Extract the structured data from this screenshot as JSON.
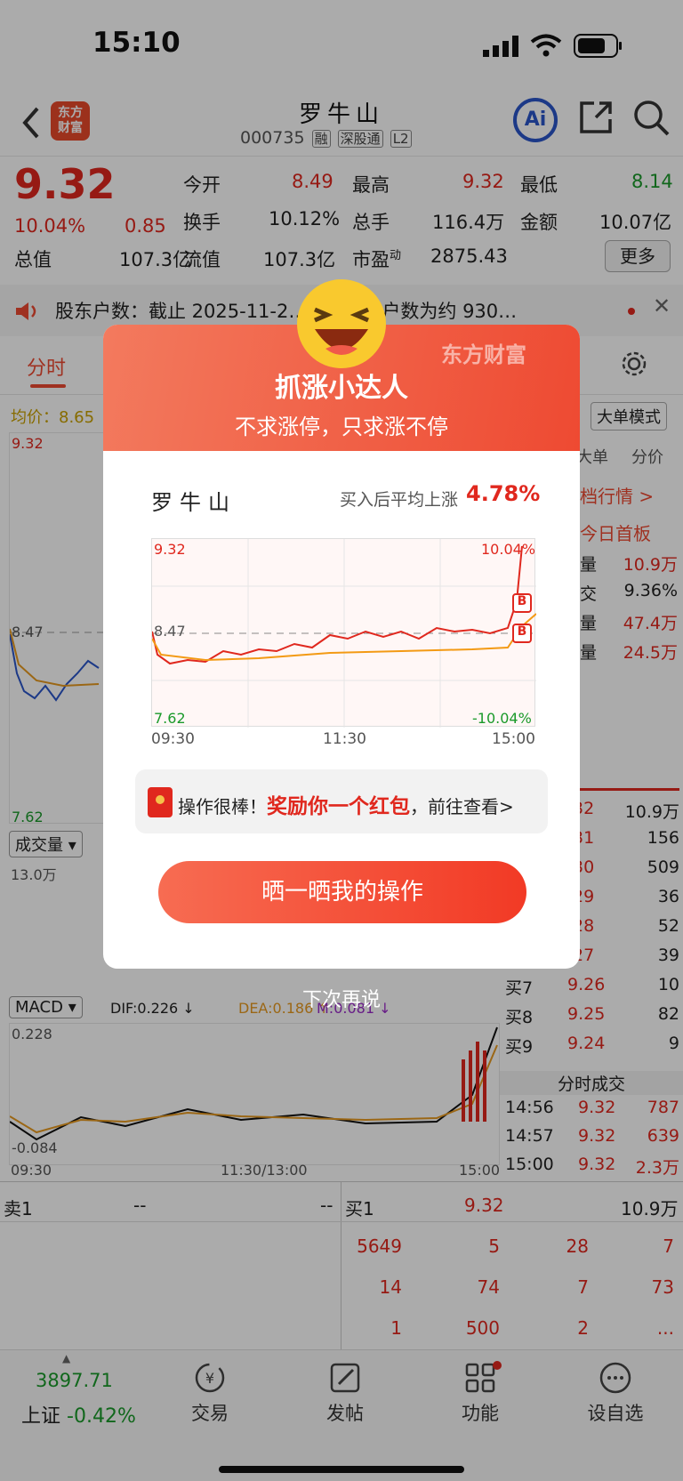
{
  "status_bar": {
    "time": "15:10"
  },
  "header": {
    "logo_text": "东方\n财富",
    "stock_name": "罗牛山",
    "code": "000735",
    "tags": [
      "融",
      "深股通",
      "L2"
    ],
    "ai_label": "Ai"
  },
  "quote": {
    "price": "9.32",
    "pct": "10.04%",
    "change": "0.85",
    "rows": [
      [
        {
          "label": "今开",
          "value": "8.49",
          "cls": "red"
        },
        {
          "label": "最高",
          "value": "9.32",
          "cls": "red"
        },
        {
          "label": "最低",
          "value": "8.14",
          "cls": "green"
        }
      ],
      [
        {
          "label": "换手",
          "value": "10.12%",
          "cls": ""
        },
        {
          "label": "总手",
          "value": "116.4万",
          "cls": ""
        },
        {
          "label": "金额",
          "value": "10.07亿",
          "cls": ""
        }
      ]
    ],
    "zongzhi_label": "总值",
    "zongzhi": "107.3亿",
    "liuzhi_label": "流值",
    "liuzhi": "107.3亿",
    "shiying_label": "市盈",
    "shiying_sup": "动",
    "shiying": "2875.43",
    "more_button": "更多"
  },
  "notice": {
    "text": "股东户数：截止 2025-11-2… A股股东户数为约 930…"
  },
  "tabs": {
    "active": "分时",
    "junjia_label": "均价：",
    "junjia": "8.65",
    "dadan_mode": "大单模式"
  },
  "right_panel": {
    "headers": [
      "大单",
      "分价"
    ],
    "link": "档行情 >",
    "first_board": "今日首板",
    "stats": [
      {
        "label": "量",
        "value": "10.9万"
      },
      {
        "label": "交",
        "value": "9.36%"
      },
      {
        "label": "量",
        "value": "47.4万"
      },
      {
        "label": "量",
        "value": "24.5万"
      }
    ],
    "book": [
      {
        "label": "",
        "price": ".32",
        "vol": "10.9万"
      },
      {
        "label": "",
        "price": ".31",
        "vol": "156"
      },
      {
        "label": "",
        "price": ".30",
        "vol": "509"
      },
      {
        "label": "",
        "price": ".29",
        "vol": "36"
      },
      {
        "label": "",
        "price": ".28",
        "vol": "52"
      },
      {
        "label": "",
        "price": ".27",
        "vol": "39"
      },
      {
        "label": "买7",
        "price": "9.26",
        "vol": "10"
      },
      {
        "label": "买8",
        "price": "9.25",
        "vol": "82"
      },
      {
        "label": "买9",
        "price": "9.24",
        "vol": "9"
      }
    ],
    "trades_title": "分时成交",
    "trades": [
      {
        "time": "14:56",
        "price": "9.32",
        "vol": "787"
      },
      {
        "time": "14:57",
        "price": "9.32",
        "vol": "639"
      },
      {
        "time": "15:00",
        "price": "9.32",
        "vol": "2.3万"
      }
    ]
  },
  "main_chart": {
    "top": "9.32",
    "ref": "8.47",
    "low": "7.62",
    "vol_label": "成交量",
    "vol_max": "13.0万",
    "macd_label": "MACD",
    "dif": "DIF:0.226 ↓",
    "dea": "DEA:0.186 ↑",
    "m": "M:0.081 ↓",
    "macd_top": "0.228",
    "macd_bottom": "-0.084",
    "x_labels": [
      "09:30",
      "11:30/13:00",
      "15:00"
    ]
  },
  "order_book_bottom": {
    "sell_label": "卖1",
    "sell_price": "--",
    "sell_vol": "--",
    "buy_label": "买1",
    "buy_price": "9.32",
    "buy_vol": "10.9万",
    "rows": [
      [
        "5649",
        "5",
        "28",
        "7"
      ],
      [
        "14",
        "74",
        "7",
        "73"
      ],
      [
        "1",
        "500",
        "2",
        "..."
      ]
    ]
  },
  "modal": {
    "title": "抓涨小达人",
    "subtitle": "不求涨停，只求涨不停",
    "watermark": "东方财富",
    "stock": "罗牛山",
    "avg_label": "买入后平均上涨",
    "avg_value": "4.78%",
    "chart": {
      "top_left": "9.32",
      "top_right": "10.04%",
      "mid": "8.47",
      "bot_left": "7.62",
      "bot_right": "-10.04%",
      "x_labels": [
        "09:30",
        "11:30",
        "15:00"
      ],
      "marker": "B"
    },
    "reward_prefix": "操作很棒！",
    "reward_highlight": "奖励你一个红包",
    "reward_suffix": "，前往查看>",
    "cta": "晒一晒我的操作",
    "dismiss": "下次再说"
  },
  "bottom_nav": {
    "index_value": "3897.71",
    "index_name": "上证",
    "index_change": "-0.42%",
    "items": [
      "交易",
      "发帖",
      "功能",
      "设自选"
    ]
  },
  "colors": {
    "up": "#e0281e",
    "down": "#1a9a2a",
    "accent": "#ee4a32"
  }
}
